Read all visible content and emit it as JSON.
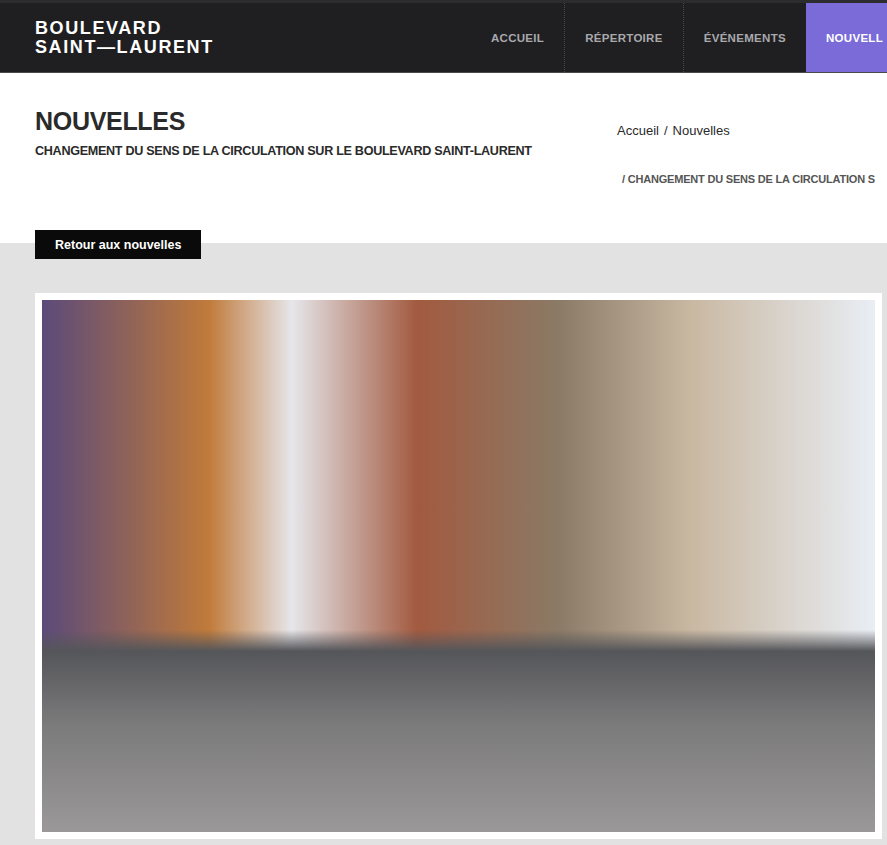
{
  "header": {
    "logo": [
      "BOULEVARD",
      "SAINT—LAURENT"
    ],
    "nav": [
      {
        "label": "ACCUEIL",
        "selected": false
      },
      {
        "label": "RÉPERTOIRE",
        "selected": false
      },
      {
        "label": "ÉVÉNEMENTS",
        "selected": false
      },
      {
        "label": "NOUVELL",
        "selected": true
      }
    ]
  },
  "page": {
    "title": "NOUVELLES",
    "subtitle": "CHANGEMENT DU SENS DE LA CIRCULATION SUR LE BOULEVARD SAINT-LAURENT",
    "breadcrumb": [
      "Accueil",
      "Nouvelles"
    ],
    "separator": "/",
    "breadcrumb_current": "CHANGEMENT DU SENS DE LA CIRCULATION S"
  },
  "button": "Retour aux nouvelles"
}
